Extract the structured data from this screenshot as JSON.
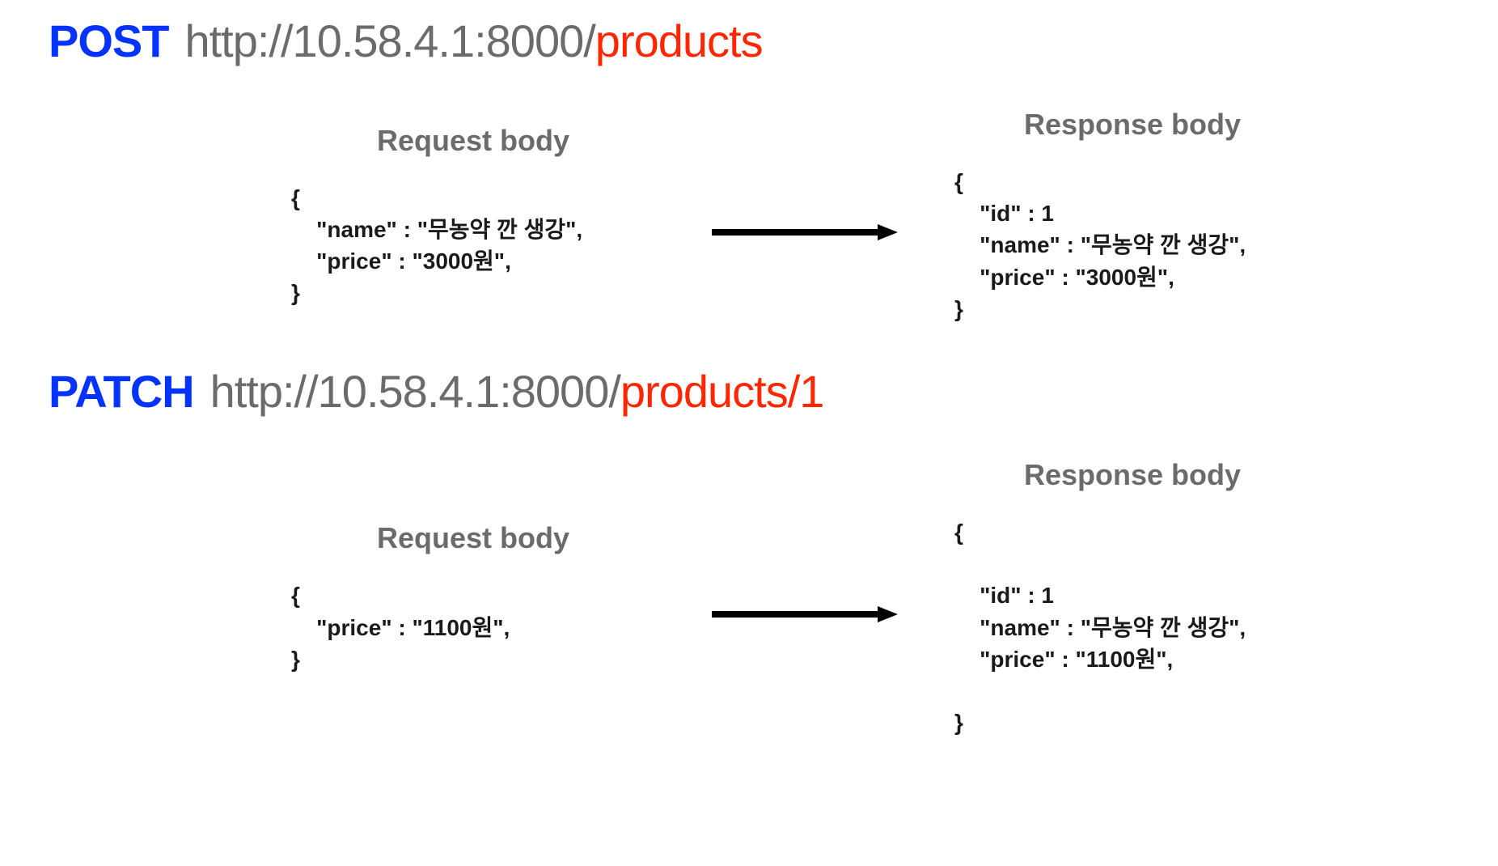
{
  "sections": [
    {
      "method": "POST",
      "url_base": "http://10.58.4.1:8000/",
      "url_path": "products",
      "request_label": "Request body",
      "response_label": "Response body",
      "request_body": "{\n    \"name\" : \"무농약 깐 생강\",\n    \"price\" : \"3000원\",\n}",
      "response_body": "{\n    \"id\" : 1\n    \"name\" : \"무농약 깐 생강\",\n    \"price\" : \"3000원\",\n}"
    },
    {
      "method": "PATCH",
      "url_base": "http://10.58.4.1:8000/",
      "url_path": "products/1",
      "request_label": "Request body",
      "response_label": "Response body",
      "request_body": "{\n    \"price\" : \"1100원\",\n}",
      "response_body": "{\n\n    \"id\" : 1\n    \"name\" : \"무농약 깐 생강\",\n    \"price\" : \"1100원\",\n\n}"
    }
  ]
}
